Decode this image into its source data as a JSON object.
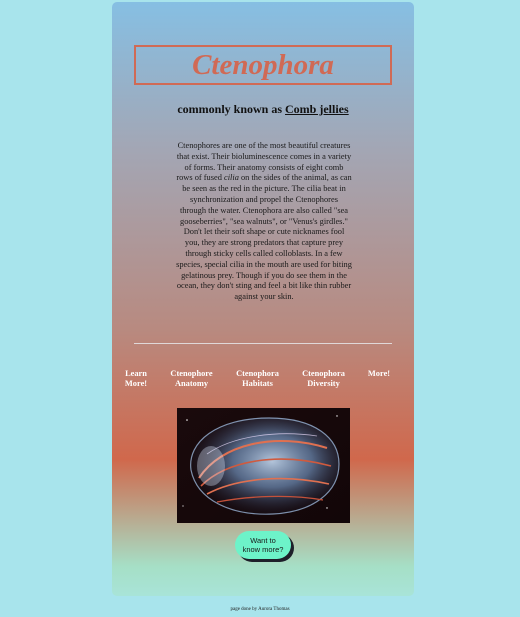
{
  "header": {
    "title": "Ctenophora",
    "subtitle_prefix": "commonly known as ",
    "subtitle_link": "Comb jellies"
  },
  "description": {
    "part1": "Ctenophores are one of the most beautiful creatures that exist. Their bioluminescence comes in a variety of forms. Their anatomy consists of eight comb rows of fused ",
    "em": "cilia",
    "part2": " on the sides of the animal, as can be seen as the red in the picture. The cilia beat in synchronization and propel the Ctenophores through the water. Ctenophora are also called \"sea gooseberries\", \"sea walnuts\", or \"Venus's girdles.\" Don't let their soft shape or cute nicknames fool you, they are strong predators that capture prey through sticky cells called colloblasts. In a few species, special cilia in the mouth are used for biting gelatinous prey. Though if you do see them in the ocean, they don't sting and feel a bit like thin rubber against your skin."
  },
  "nav": {
    "learn_line1": "Learn",
    "learn_line2": "More!",
    "anatomy_line1": "Ctenophore",
    "anatomy_line2": "Anatomy",
    "habitats_line1": "Ctenophora",
    "habitats_line2": "Habitats",
    "diversity_line1": "Ctenophora",
    "diversity_line2": "Diversity",
    "more": "More!"
  },
  "cta": {
    "line1": "Want to",
    "line2": "know more?"
  },
  "footer": "page done by Aurora Thomas",
  "colors": {
    "page_bg": "#a8e4ec",
    "title": "#d06a55",
    "cta_bg": "#6df3c9"
  }
}
